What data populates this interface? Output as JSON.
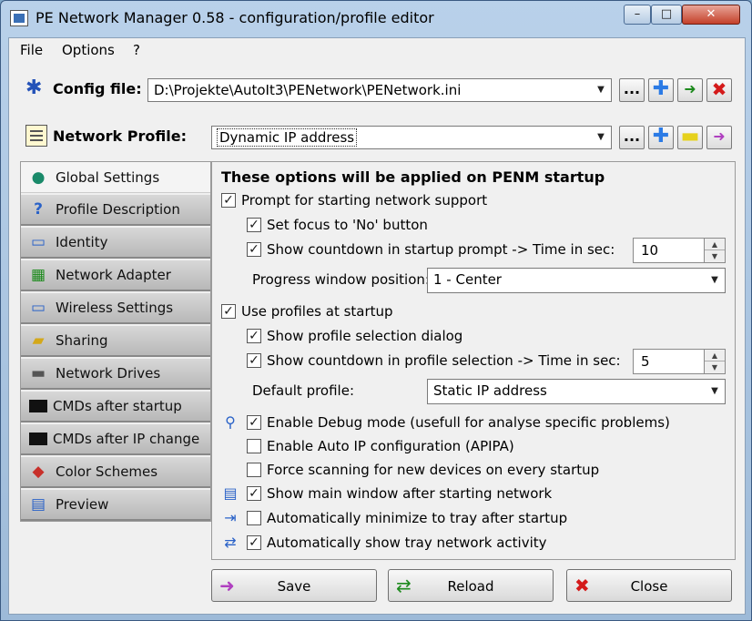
{
  "window": {
    "title": "PE Network Manager 0.58 - configuration/profile editor",
    "min": "–",
    "max": "□",
    "close": "✕"
  },
  "menu": {
    "file": "File",
    "options": "Options",
    "help": "?"
  },
  "config": {
    "label": "Config file:",
    "value": "D:\\Projekte\\AutoIt3\\PENetwork\\PENetwork.ini",
    "browse": "..."
  },
  "profile": {
    "label": "Network Profile:",
    "value": "Dynamic IP address",
    "browse": "..."
  },
  "sidebar": {
    "items": [
      {
        "label": "Global Settings",
        "icon": "globe-icon",
        "glyph": "●"
      },
      {
        "label": "Profile Description",
        "icon": "question-icon",
        "glyph": "?"
      },
      {
        "label": "Identity",
        "icon": "monitor-icon",
        "glyph": "▭"
      },
      {
        "label": "Network Adapter",
        "icon": "network-card-icon",
        "glyph": "▦"
      },
      {
        "label": "Wireless Settings",
        "icon": "wireless-icon",
        "glyph": "▭"
      },
      {
        "label": "Sharing",
        "icon": "folder-share-icon",
        "glyph": "▰"
      },
      {
        "label": "Network Drives",
        "icon": "network-drive-icon",
        "glyph": "▬"
      },
      {
        "label": "CMDs after startup",
        "icon": "console-icon",
        "glyph": "▪"
      },
      {
        "label": "CMDs after IP change",
        "icon": "console-icon",
        "glyph": "▪"
      },
      {
        "label": "Color Schemes",
        "icon": "color-icon",
        "glyph": "◆"
      },
      {
        "label": "Preview",
        "icon": "preview-icon",
        "glyph": "▤"
      }
    ]
  },
  "panel": {
    "heading": "These options will be applied on PENM startup",
    "prompt_start": "Prompt for starting network support",
    "set_focus_no": "Set focus to 'No' button",
    "countdown_startup": "Show countdown in startup prompt  ->  Time in sec:",
    "countdown_startup_value": "10",
    "progress_position_label": "Progress window position:",
    "progress_position_value": "1 - Center",
    "use_profiles": "Use profiles at startup",
    "show_profile_dialog": "Show profile selection dialog",
    "countdown_profile": "Show countdown in profile selection  ->  Time in sec:",
    "countdown_profile_value": "5",
    "default_profile_label": "Default profile:",
    "default_profile_value": "Static IP address",
    "debug_mode": "Enable Debug mode (usefull for analyse specific problems)",
    "auto_ip": "Enable Auto IP configuration (APIPA)",
    "force_scan": "Force scanning for new devices on every startup",
    "show_main_window": "Show main window after starting network",
    "auto_minimize": "Automatically minimize to tray after startup",
    "tray_activity": "Automatically show tray network activity"
  },
  "buttons": {
    "save": "Save",
    "reload": "Reload",
    "close": "Close"
  }
}
